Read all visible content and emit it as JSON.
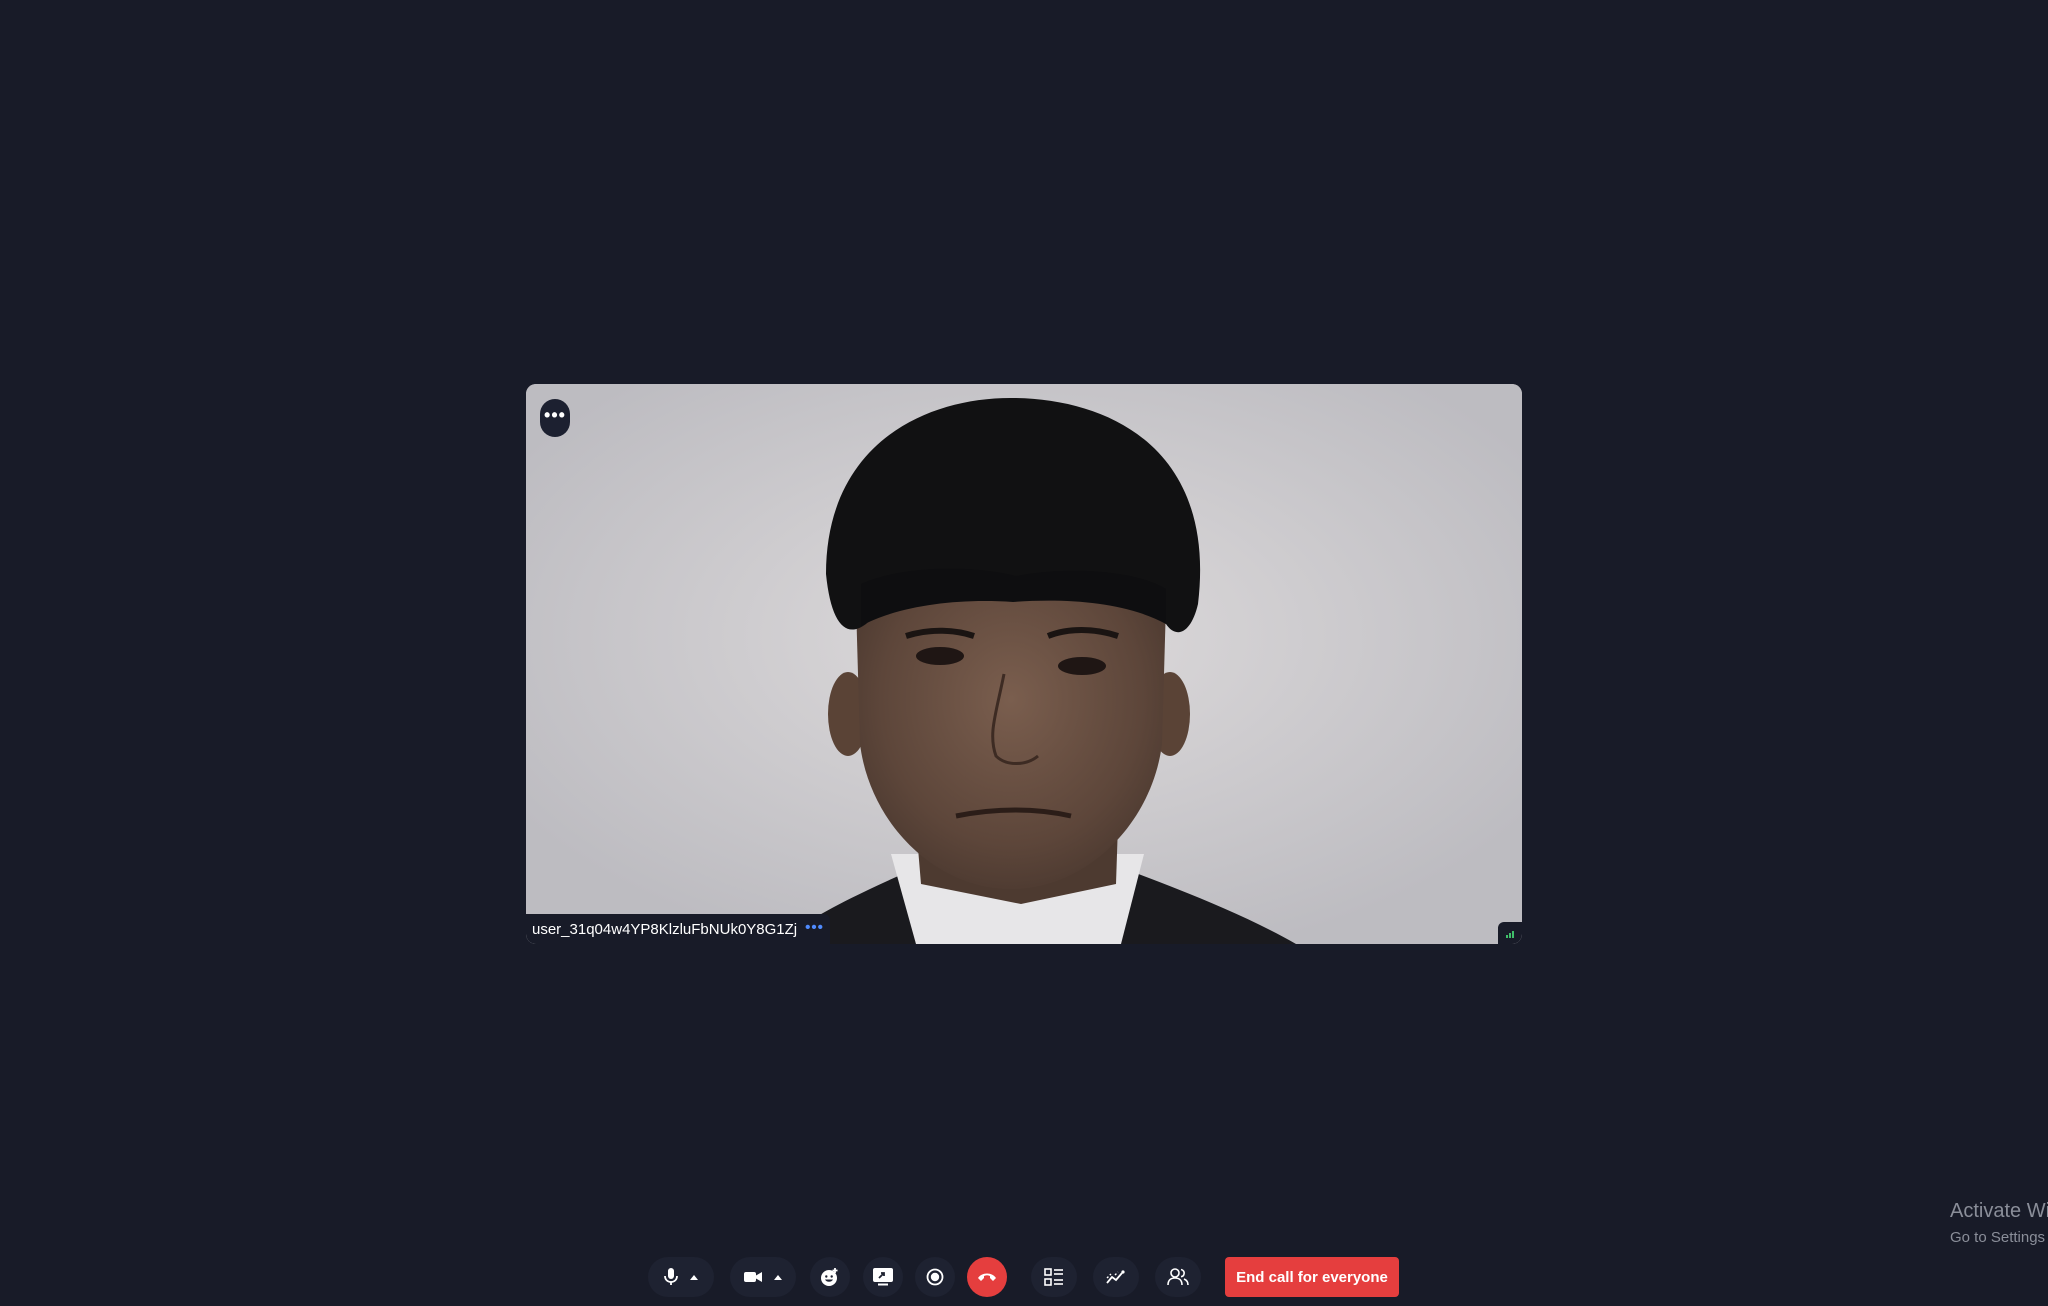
{
  "participant": {
    "name": "user_31q04w4YP8KlzluFbNUk0Y8G1Zj",
    "tile_menu_label": "•••",
    "name_more_label": "•••",
    "network_quality_icon": "signal-bars-icon"
  },
  "watermark": {
    "line1": "Activate Wi",
    "line2": "Go to Settings"
  },
  "controls": {
    "items": [
      {
        "name": "microphone-button",
        "icon": "microphone-icon",
        "has_caret": true
      },
      {
        "name": "camera-button",
        "icon": "video-camera-icon",
        "has_caret": true
      },
      {
        "name": "reactions-button",
        "icon": "emoji-icon"
      },
      {
        "name": "screen-share-button",
        "icon": "screen-share-icon"
      },
      {
        "name": "record-button",
        "icon": "record-icon"
      },
      {
        "name": "leave-call-button",
        "icon": "phone-hangup-icon"
      },
      {
        "name": "layout-button",
        "icon": "layout-list-icon"
      },
      {
        "name": "stats-button",
        "icon": "stats-icon"
      },
      {
        "name": "participants-button",
        "icon": "people-icon"
      }
    ],
    "end_call_for_everyone_label": "End call for everyone"
  },
  "colors": {
    "background": "#181b28",
    "control_bg": "#1e2231",
    "danger": "#e53e3e",
    "accent": "#4f8bff",
    "signal": "#3fbf6a"
  }
}
